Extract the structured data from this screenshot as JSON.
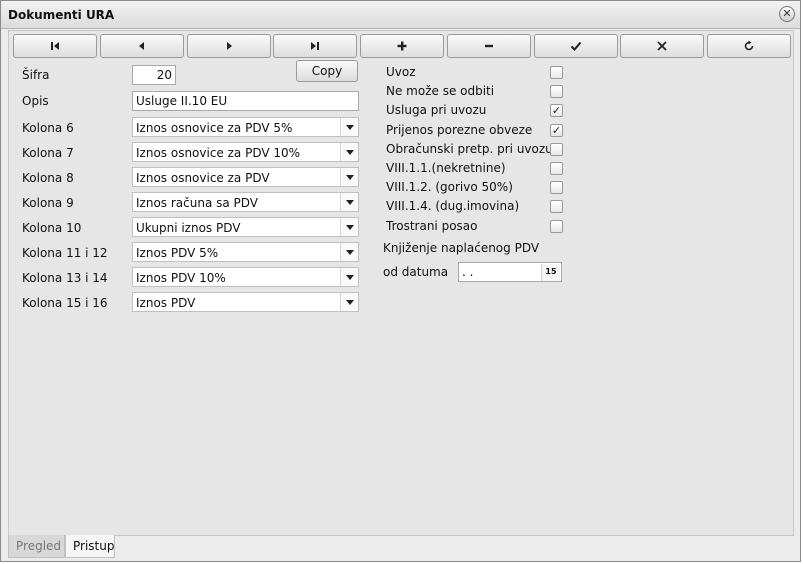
{
  "window": {
    "title": "Dokumenti URA",
    "close_icon": "close-icon"
  },
  "toolbar": {
    "buttons": [
      {
        "name": "first-record-button",
        "icon": "first-icon"
      },
      {
        "name": "prev-record-button",
        "icon": "prev-icon"
      },
      {
        "name": "next-record-button",
        "icon": "next-icon"
      },
      {
        "name": "last-record-button",
        "icon": "last-icon"
      },
      {
        "name": "add-button",
        "icon": "plus-icon"
      },
      {
        "name": "delete-button",
        "icon": "minus-icon"
      },
      {
        "name": "confirm-button",
        "icon": "check-icon"
      },
      {
        "name": "cancel-button",
        "icon": "x-icon"
      },
      {
        "name": "refresh-button",
        "icon": "refresh-icon"
      }
    ]
  },
  "form": {
    "sifra_label": "Šifra",
    "sifra_value": "20",
    "copy_label": "Copy",
    "opis_label": "Opis",
    "opis_value": "Usluge II.10 EU",
    "columns": [
      {
        "label": "Kolona 6",
        "value": "Iznos osnovice za PDV 5%"
      },
      {
        "label": "Kolona 7",
        "value": "Iznos osnovice za PDV 10%"
      },
      {
        "label": "Kolona 8",
        "value": "Iznos osnovice za PDV"
      },
      {
        "label": "Kolona 9",
        "value": "Iznos računa sa PDV"
      },
      {
        "label": "Kolona 10",
        "value": "Ukupni iznos PDV"
      },
      {
        "label": "Kolona 11 i 12",
        "value": "Iznos PDV 5%"
      },
      {
        "label": "Kolona 13 i 14",
        "value": "Iznos PDV 10%"
      },
      {
        "label": "Kolona 15 i 16",
        "value": "Iznos PDV"
      }
    ]
  },
  "options": [
    {
      "label": "Uvoz",
      "checked": false
    },
    {
      "label": "Ne može se odbiti",
      "checked": false
    },
    {
      "label": "Usluga pri uvozu",
      "checked": true
    },
    {
      "label": "Prijenos porezne obveze",
      "checked": true
    },
    {
      "label": "Obračunski pretp. pri uvozu",
      "checked": false
    },
    {
      "label": "VIII.1.1.(nekretnine)",
      "checked": false
    },
    {
      "label": "VIII.1.2. (gorivo 50%)",
      "checked": false
    },
    {
      "label": "VIII.1.4. (dug.imovina)",
      "checked": false
    },
    {
      "label": "Trostrani posao",
      "checked": false
    }
  ],
  "knjizenje": {
    "title": "Knjiženje naplaćenog PDV",
    "od_label": "od datuma",
    "date_value": " .  .",
    "calendar_icon": "calendar-icon",
    "calendar_glyph": "15"
  },
  "tabs": [
    {
      "label": "Pregled",
      "active": false
    },
    {
      "label": "Pristup",
      "active": true
    }
  ]
}
